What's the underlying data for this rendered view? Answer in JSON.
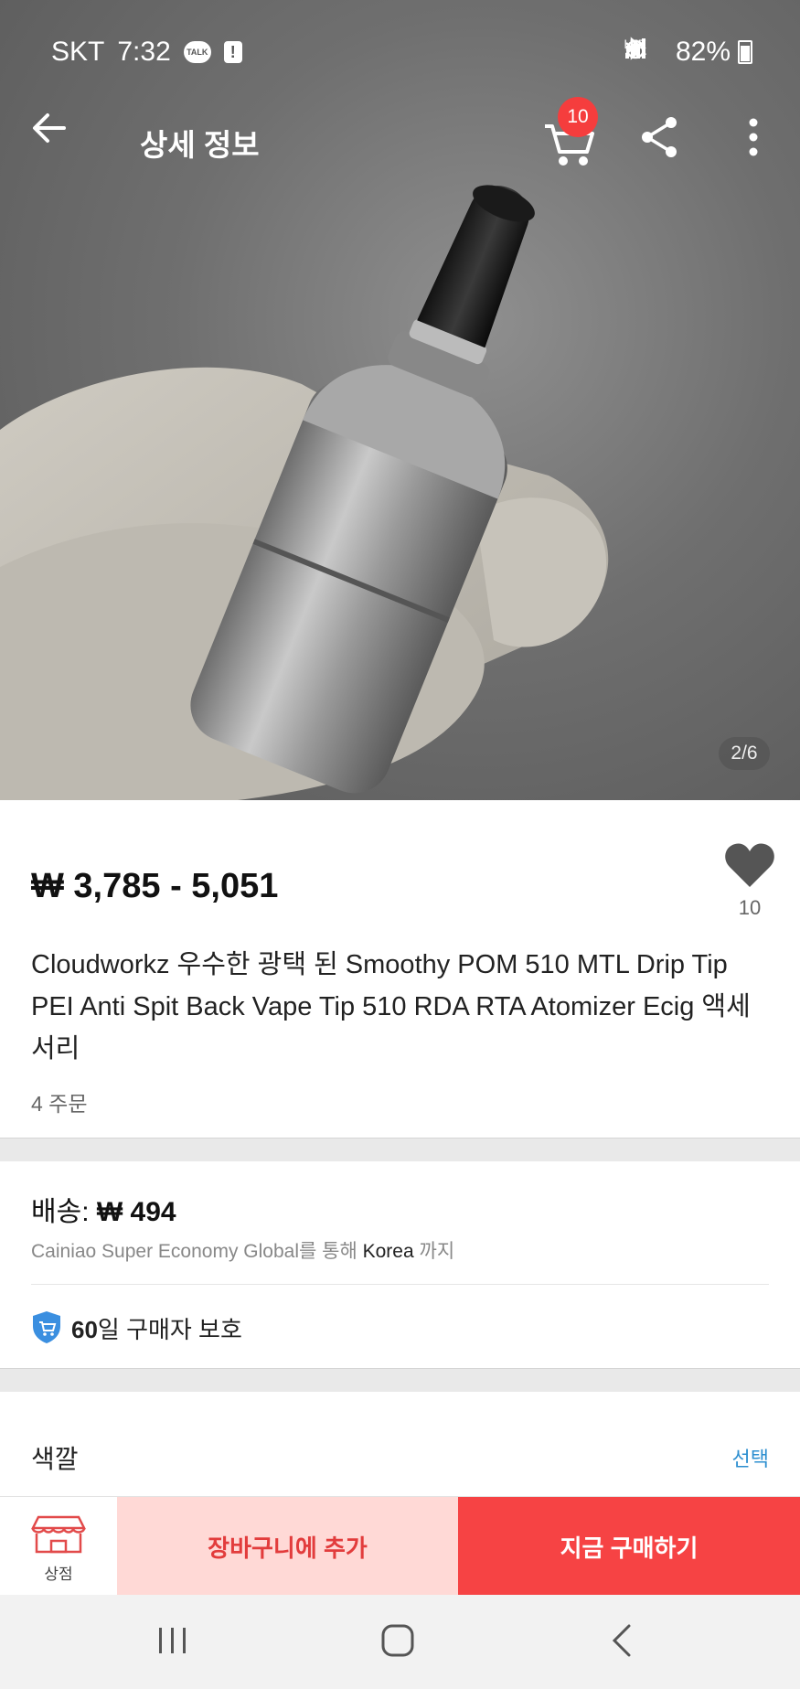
{
  "status_bar": {
    "carrier": "SKT",
    "time": "7:32",
    "network": "LTE",
    "battery": "82%",
    "icons": [
      "talk-icon",
      "alert-icon",
      "alarm-icon",
      "bluetooth-icon",
      "mute-icon",
      "lte-icon",
      "signal-icon",
      "battery-icon"
    ]
  },
  "app_bar": {
    "title": "상세 정보",
    "cart_count": "10"
  },
  "gallery": {
    "pager": "2/6"
  },
  "product": {
    "price": "₩ 3,785 - 5,051",
    "wishlist_count": "10",
    "title": "Cloudworkz 우수한 광택 된 Smoothy POM 510 MTL Drip Tip PEI Anti Spit Back Vape Tip 510 RDA RTA Atomizer Ecig 액세서리",
    "orders": "4 주문"
  },
  "shipping": {
    "label": "배송: ",
    "cost": "₩ 494",
    "carrier": "Cainiao Super Economy Global를 통해 ",
    "destination": "Korea",
    "suffix": " 까지"
  },
  "protection": {
    "days": "60",
    "text": "일 구매자 보호"
  },
  "options": {
    "color_label": "색깔",
    "select_label": "선택"
  },
  "action_bar": {
    "store_label": "상점",
    "add_to_cart": "장바구니에 추가",
    "buy_now": "지금 구매하기"
  },
  "colors": {
    "accent_red": "#f64344",
    "light_red": "#ffd9d6",
    "link_blue": "#2d8fd0",
    "badge_red": "#f53d3d"
  }
}
